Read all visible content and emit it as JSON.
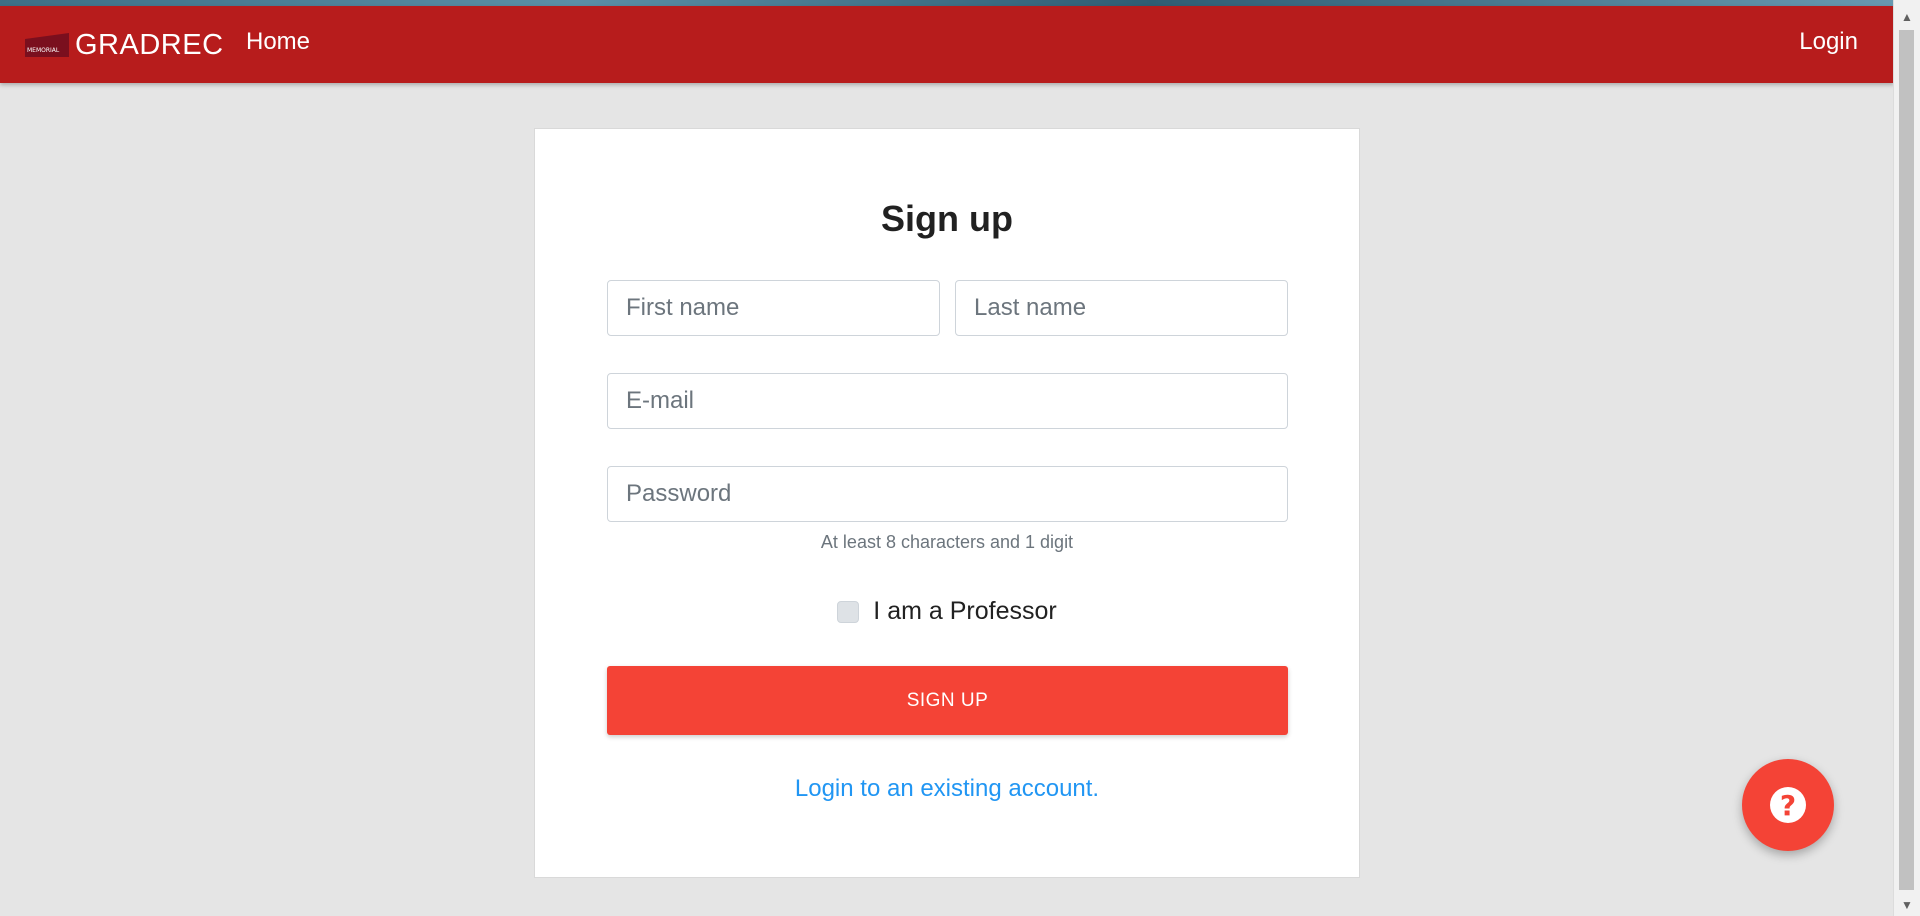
{
  "navbar": {
    "brand_logo_text": "MEMORIAL",
    "brand_name": "GRADREC",
    "home_label": "Home",
    "login_label": "Login"
  },
  "form": {
    "title": "Sign up",
    "first_name_placeholder": "First name",
    "last_name_placeholder": "Last name",
    "email_placeholder": "E-mail",
    "password_placeholder": "Password",
    "password_hint": "At least 8 characters and 1 digit",
    "professor_label": "I am a Professor",
    "professor_checked": false,
    "submit_label": "SIGN UP",
    "login_link": "Login to an existing account."
  },
  "help_button": {
    "icon": "help-circle-icon",
    "glyph": "?"
  },
  "colors": {
    "navbar": "#b71c1c",
    "primary_button": "#f44336",
    "link": "#2196f3",
    "background": "#e5e5e5"
  }
}
